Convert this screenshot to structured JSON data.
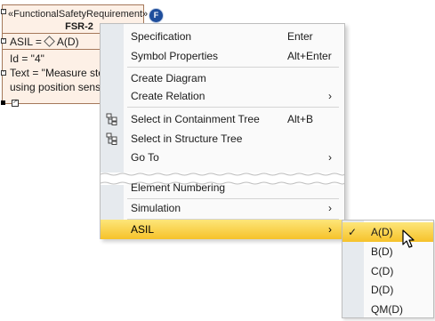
{
  "shape": {
    "stereotype": "«FunctionalSafetyRequirement»",
    "badge": "F",
    "name": "FSR-2",
    "asil_line": "ASIL =",
    "asil_value": "A(D)",
    "id_line": "Id = \"4\"",
    "text_line1": "Text = \"Measure ste",
    "text_line2": "using position sens"
  },
  "menu": {
    "items": [
      {
        "label": "Specification",
        "accel": "Enter"
      },
      {
        "label": "Symbol Properties",
        "accel": "Alt+Enter"
      },
      {
        "label": "Create Diagram"
      },
      {
        "label": "Create Relation",
        "arrow": "›"
      },
      {
        "label": "Select in Containment Tree",
        "accel": "Alt+B",
        "icon": "containment-tree-icon"
      },
      {
        "label": "Select in Structure Tree",
        "icon": "structure-tree-icon"
      },
      {
        "label": "Go To",
        "arrow": "›"
      },
      {
        "label": "Element Numbering"
      },
      {
        "label": "Simulation",
        "arrow": "›"
      },
      {
        "label": "ASIL",
        "arrow": "›",
        "highlighted": true
      }
    ]
  },
  "submenu": {
    "items": [
      {
        "label": "A(D)",
        "checked": true,
        "highlighted": true
      },
      {
        "label": "B(D)"
      },
      {
        "label": "C(D)"
      },
      {
        "label": "D(D)"
      },
      {
        "label": "QM(D)"
      }
    ],
    "check_glyph": "✓"
  },
  "colors": {
    "highlight": "#f6c22a",
    "gutter": "#e6eaee",
    "shape_fill": "#fdf0e6",
    "badge": "#1f4e9c"
  }
}
